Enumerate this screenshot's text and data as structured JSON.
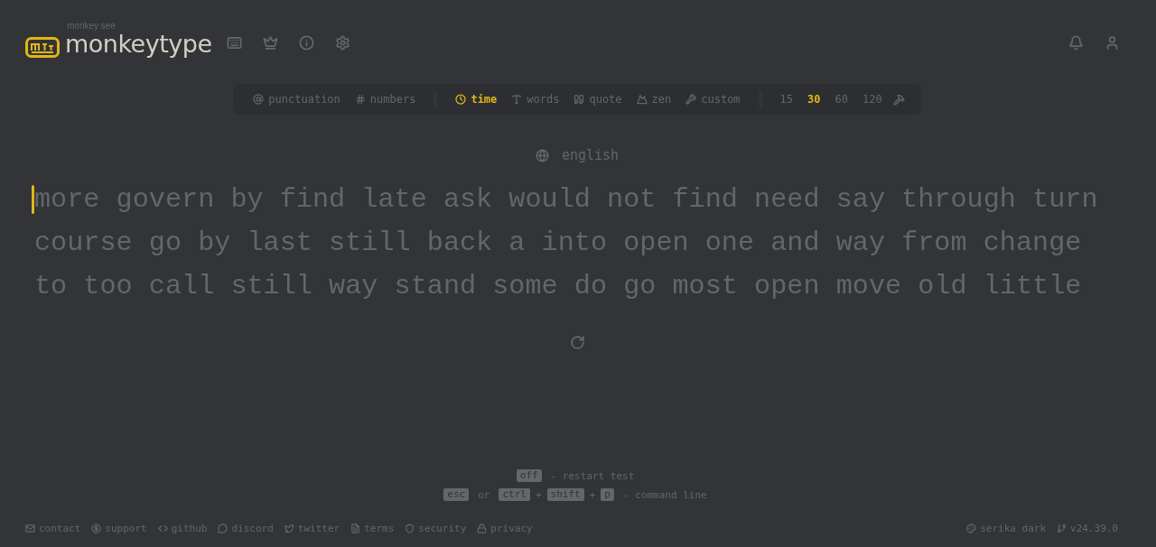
{
  "header": {
    "logo_caption": "monkey see",
    "logo_name": "monkeytype",
    "nav": [
      {
        "kind": "keyboard"
      },
      {
        "kind": "crown"
      },
      {
        "kind": "info"
      },
      {
        "kind": "settings"
      }
    ],
    "account": [
      {
        "kind": "bell"
      },
      {
        "kind": "user"
      }
    ]
  },
  "config_bar": {
    "toggles": [
      {
        "kind": "at",
        "label": "punctuation",
        "selected": false
      },
      {
        "kind": "hash",
        "label": "numbers",
        "selected": false
      }
    ],
    "modes": [
      {
        "kind": "clock",
        "label": "time",
        "selected": true
      },
      {
        "kind": "letter",
        "label": "words",
        "selected": false
      },
      {
        "kind": "quote",
        "label": "quote",
        "selected": false
      },
      {
        "kind": "mountain",
        "label": "zen",
        "selected": false
      },
      {
        "kind": "wrench",
        "label": "custom",
        "selected": false
      }
    ],
    "durations": [
      {
        "label": "15",
        "selected": false
      },
      {
        "label": "30",
        "selected": true
      },
      {
        "label": "60",
        "selected": false
      },
      {
        "label": "120",
        "selected": false
      }
    ]
  },
  "language": "english",
  "words_lines": [
    "more govern by find late ask would not find need say through turn",
    "course go by last still back a into open one and way from change",
    "to too call still way stand some do go most open move old little"
  ],
  "hints": [
    [
      {
        "kind": "key",
        "text": "off"
      },
      {
        "kind": "text",
        "text": "- restart test"
      }
    ],
    [
      {
        "kind": "key",
        "text": "esc"
      },
      {
        "kind": "text",
        "text": "or"
      },
      {
        "kind": "key",
        "text": "ctrl"
      },
      {
        "kind": "plus",
        "text": "+"
      },
      {
        "kind": "key",
        "text": "shift"
      },
      {
        "kind": "plus",
        "text": "+"
      },
      {
        "kind": "key",
        "text": "p"
      },
      {
        "kind": "text",
        "text": "- command line"
      }
    ]
  ],
  "footer_links": [
    {
      "kind": "mail",
      "label": "contact"
    },
    {
      "kind": "donate",
      "label": "support"
    },
    {
      "kind": "code",
      "label": "github"
    },
    {
      "kind": "chat",
      "label": "discord"
    },
    {
      "kind": "bird",
      "label": "twitter"
    },
    {
      "kind": "file",
      "label": "terms"
    },
    {
      "kind": "shield",
      "label": "security"
    },
    {
      "kind": "lock",
      "label": "privacy"
    }
  ],
  "footer_right": [
    {
      "kind": "palette",
      "label": "serika dark"
    },
    {
      "kind": "branch",
      "label": "v24.39.0"
    }
  ]
}
